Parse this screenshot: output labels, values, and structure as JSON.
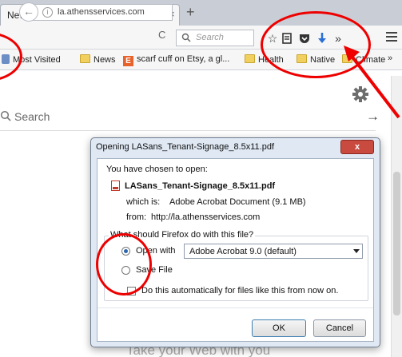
{
  "browser": {
    "tab": {
      "title": "New Tab",
      "close": "×",
      "new_tab": "+"
    },
    "nav": {
      "back": "←",
      "info": "i",
      "url": "la.athensservices.com",
      "reload": "C",
      "search_placeholder": "Search",
      "toolbar_icons": [
        "star-icon",
        "reading-list-icon",
        "pocket-icon",
        "download-icon",
        "overflow-icon",
        "hamburger-menu-icon"
      ],
      "overflow": "»"
    },
    "bookmarks": [
      {
        "label": "Most Visited",
        "icon": "most-visited-icon"
      },
      {
        "label": "News",
        "icon": "folder-icon"
      },
      {
        "label": "scarf cuff on Etsy, a gl...",
        "icon": "etsy-icon"
      },
      {
        "label": "Health",
        "icon": "folder-icon"
      },
      {
        "label": "Native",
        "icon": "folder-icon"
      },
      {
        "label": "Climate",
        "icon": "folder-icon"
      }
    ],
    "bookmarks_more": "»",
    "etsy_letter": "E"
  },
  "newtab_page": {
    "search_label": "Search",
    "go": "→",
    "tagline": "Take your Web with you"
  },
  "dialog": {
    "title": "Opening LASans_Tenant-Signage_8.5x11.pdf",
    "close": "x",
    "intro": "You have chosen to open:",
    "filename": "LASans_Tenant-Signage_8.5x11.pdf",
    "which_is_label": "which is:",
    "which_is_value": "Adobe Acrobat Document (9.1 MB)",
    "from_label": "from:",
    "from_value": "http://la.athensservices.com",
    "question": "What should Firefox do with this file?",
    "open_with_label": "Open with",
    "open_with_selected": true,
    "app": "Adobe Acrobat 9.0 (default)",
    "save_file_label": "Save File",
    "auto_label": "Do this automatically for files like this from now on.",
    "auto_checked": false,
    "ok": "OK",
    "cancel": "Cancel"
  },
  "colors": {
    "annotation": "#e00000",
    "download_arrow": "#2a6fd6",
    "close_button": "#c94a3f"
  }
}
